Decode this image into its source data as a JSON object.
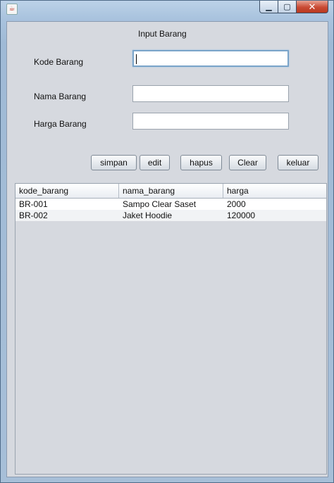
{
  "window": {
    "app_icon": "java-cup-icon",
    "controls": {
      "minimize_icon": "minimize-icon",
      "maximize_icon": "maximize-icon",
      "close_icon": "close-icon"
    }
  },
  "form": {
    "heading": "Input Barang",
    "fields": {
      "kode": {
        "label": "Kode Barang",
        "value": ""
      },
      "nama": {
        "label": "Nama Barang",
        "value": ""
      },
      "harga": {
        "label": "Harga Barang",
        "value": ""
      }
    },
    "buttons": {
      "simpan": "simpan",
      "edit": "edit",
      "hapus": "hapus",
      "clear": "Clear",
      "keluar": "keluar"
    }
  },
  "table": {
    "columns": [
      "kode_barang",
      "nama_barang",
      "harga"
    ],
    "rows": [
      [
        "BR-001",
        "Sampo Clear Saset",
        "2000"
      ],
      [
        "BR-002",
        "Jaket Hoodie",
        "120000"
      ]
    ]
  }
}
